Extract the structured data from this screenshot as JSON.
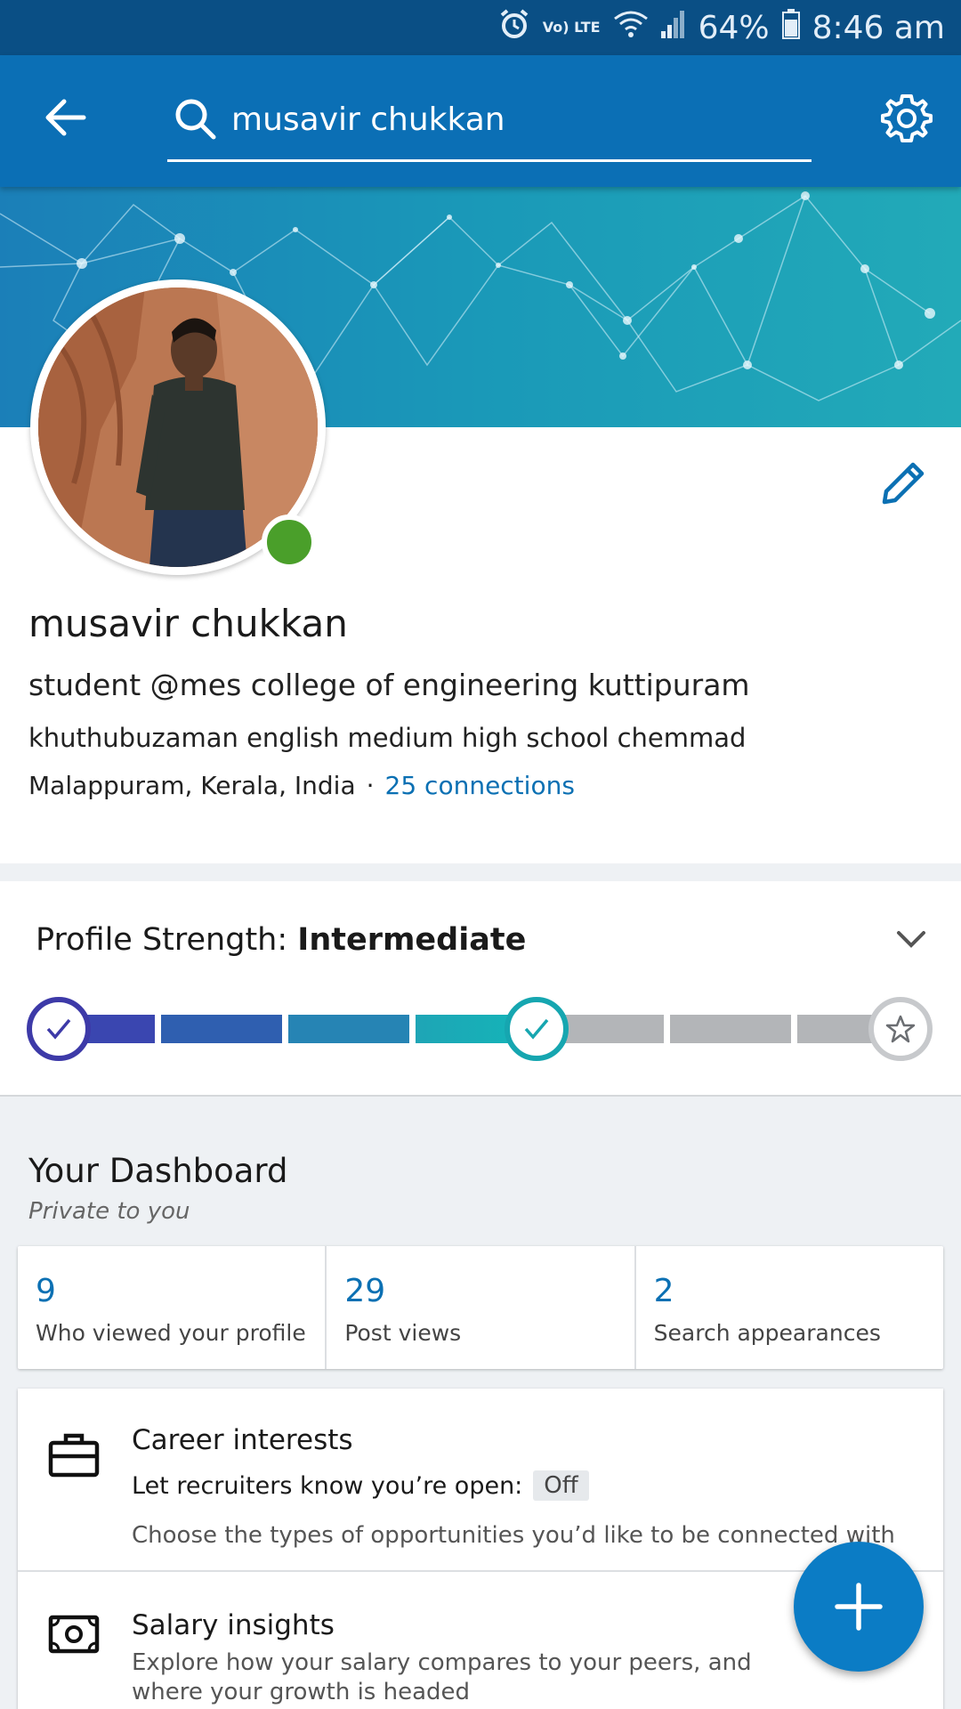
{
  "status_bar": {
    "network": "Vo) LTE",
    "battery_percent": "64%",
    "time": "8:46 am"
  },
  "app_bar": {
    "search_value": "musavir chukkan",
    "back_icon": "arrow-left-icon",
    "search_icon": "search-icon",
    "settings_icon": "gear-icon"
  },
  "profile": {
    "name": "musavir chukkan",
    "headline": "student @mes college of engineering kuttipuram",
    "school": "khuthubuzaman english medium high school chemmad",
    "location": "Malappuram, Kerala, India",
    "separator": "·",
    "connections": "25 connections",
    "online": true
  },
  "profile_strength": {
    "label": "Profile Strength:",
    "level": "Intermediate",
    "steps_total": 7,
    "steps_completed": 4
  },
  "dashboard": {
    "title": "Your Dashboard",
    "subtitle": "Private to you",
    "stats": [
      {
        "value": "9",
        "label": "Who viewed your profile"
      },
      {
        "value": "29",
        "label": "Post views"
      },
      {
        "value": "2",
        "label": "Search appearances"
      }
    ]
  },
  "career_interests": {
    "title": "Career interests",
    "open_label": "Let recruiters know you’re open:",
    "open_value": "Off",
    "description": "Choose the types of opportunities you’d like to be connected with"
  },
  "salary_insights": {
    "title": "Salary insights",
    "description": "Explore how your salary compares to your peers, and where your growth is headed"
  },
  "colors": {
    "app_bar": "#0b6fb5",
    "status_bar": "#0a4f85",
    "link": "#0b70b3",
    "online": "#4a9f2a",
    "fab": "#0b7cc5"
  }
}
